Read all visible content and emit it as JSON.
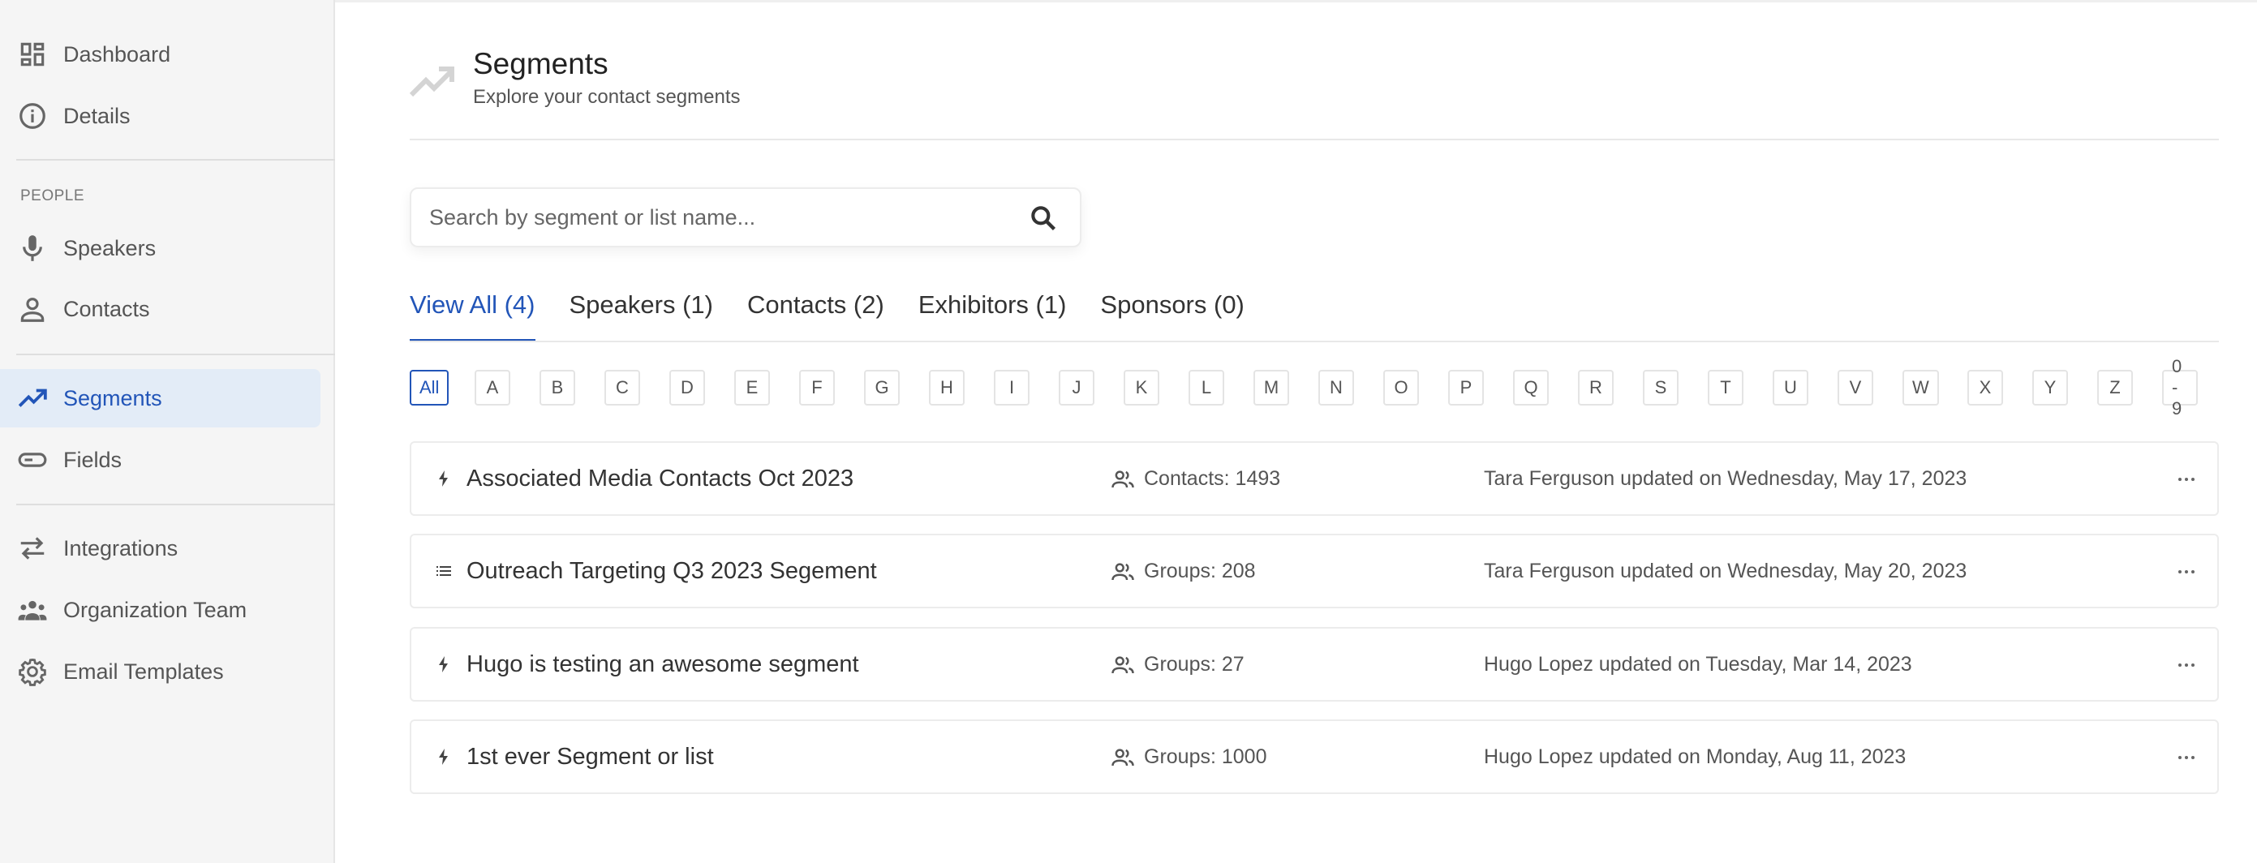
{
  "sidebar": {
    "items": [
      {
        "label": "Dashboard",
        "icon": "dashboard-icon"
      },
      {
        "label": "Details",
        "icon": "info-icon"
      },
      {
        "label": "Speakers",
        "icon": "microphone-icon"
      },
      {
        "label": "Contacts",
        "icon": "person-icon"
      },
      {
        "label": "Segments",
        "icon": "trending-up-icon"
      },
      {
        "label": "Fields",
        "icon": "input-field-icon"
      },
      {
        "label": "Integrations",
        "icon": "swap-arrows-icon"
      },
      {
        "label": "Organization Team",
        "icon": "group-icon"
      },
      {
        "label": "Email Templates",
        "icon": "gear-icon"
      }
    ],
    "section_people": "PEOPLE",
    "active": "Segments"
  },
  "header": {
    "title": "Segments",
    "subtitle": "Explore your contact segments"
  },
  "search": {
    "placeholder": "Search by segment or list name..."
  },
  "tabs": [
    {
      "label": "View All (4)"
    },
    {
      "label": "Speakers (1)"
    },
    {
      "label": "Contacts (2)"
    },
    {
      "label": "Exhibitors (1)"
    },
    {
      "label": "Sponsors (0)"
    }
  ],
  "letters": [
    "All",
    "A",
    "B",
    "C",
    "D",
    "E",
    "F",
    "G",
    "H",
    "I",
    "J",
    "K",
    "L",
    "M",
    "N",
    "O",
    "P",
    "Q",
    "R",
    "S",
    "T",
    "U",
    "V",
    "W",
    "X",
    "Y",
    "Z",
    "0 - 9"
  ],
  "segments": [
    {
      "type_icon": "bolt-icon",
      "name": "Associated Media Contacts Oct 2023",
      "count": "Contacts: 1493",
      "updated": "Tara Ferguson updated on Wednesday, May 17, 2023"
    },
    {
      "type_icon": "list-icon",
      "name": "Outreach Targeting Q3 2023 Segement",
      "count": "Groups: 208",
      "updated": "Tara Ferguson updated on Wednesday, May 20, 2023"
    },
    {
      "type_icon": "bolt-icon",
      "name": "Hugo is testing an awesome segment",
      "count": "Groups: 27",
      "updated": "Hugo Lopez updated on Tuesday, Mar 14, 2023"
    },
    {
      "type_icon": "bolt-icon",
      "name": "1st ever Segment or list",
      "count": "Groups: 1000",
      "updated": "Hugo Lopez updated on Monday, Aug 11, 2023"
    }
  ],
  "colors": {
    "accent": "#2255b8",
    "active_bg": "#e3ecf7",
    "sidebar_bg": "#f5f5f5"
  }
}
